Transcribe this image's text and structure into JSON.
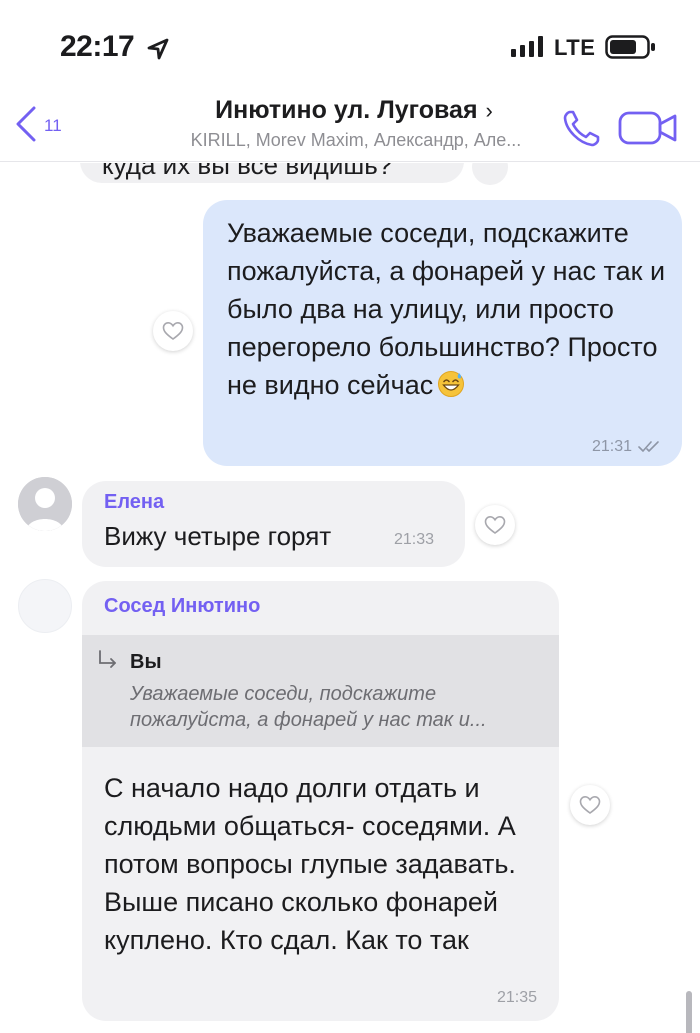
{
  "status_bar": {
    "time": "22:17",
    "network": "LTE",
    "icons": [
      "location-arrow-icon",
      "signal-bars-icon",
      "battery-icon"
    ]
  },
  "header": {
    "back_count": "11",
    "title": "Инютино ул. Луговая",
    "title_chevron": "›",
    "members": "KIRILL, Morev Maxim, Александр, Але...",
    "accent_color": "#7360f2"
  },
  "messages": {
    "previous_partial": {
      "text": "куда их вы всё видишь?"
    },
    "outgoing": {
      "text": "Уважаемые соседи, подскажите пожалуйста, а фонарей у нас так и было два на улицу, или просто перегорело большинство? Просто не видно сейчас",
      "emoji": "grinning-sweat-emoji",
      "time": "21:31",
      "status": "read-double-check-icon",
      "bubble_color": "#dbe7fb"
    },
    "elena": {
      "sender": "Елена",
      "text": "Вижу четыре горят",
      "time": "21:33"
    },
    "sosed": {
      "sender": "Сосед Инютино",
      "reply_author": "Вы",
      "reply_text": "Уважаемые соседи, подскажите пожалуйста, а фонарей у нас так и...",
      "text": "С начало надо долги отдать и слюдьми общаться- соседями. А потом вопросы глупые задавать. Выше писано сколько фонарей куплено. Кто сдал. Как то так",
      "time": "21:35"
    }
  }
}
